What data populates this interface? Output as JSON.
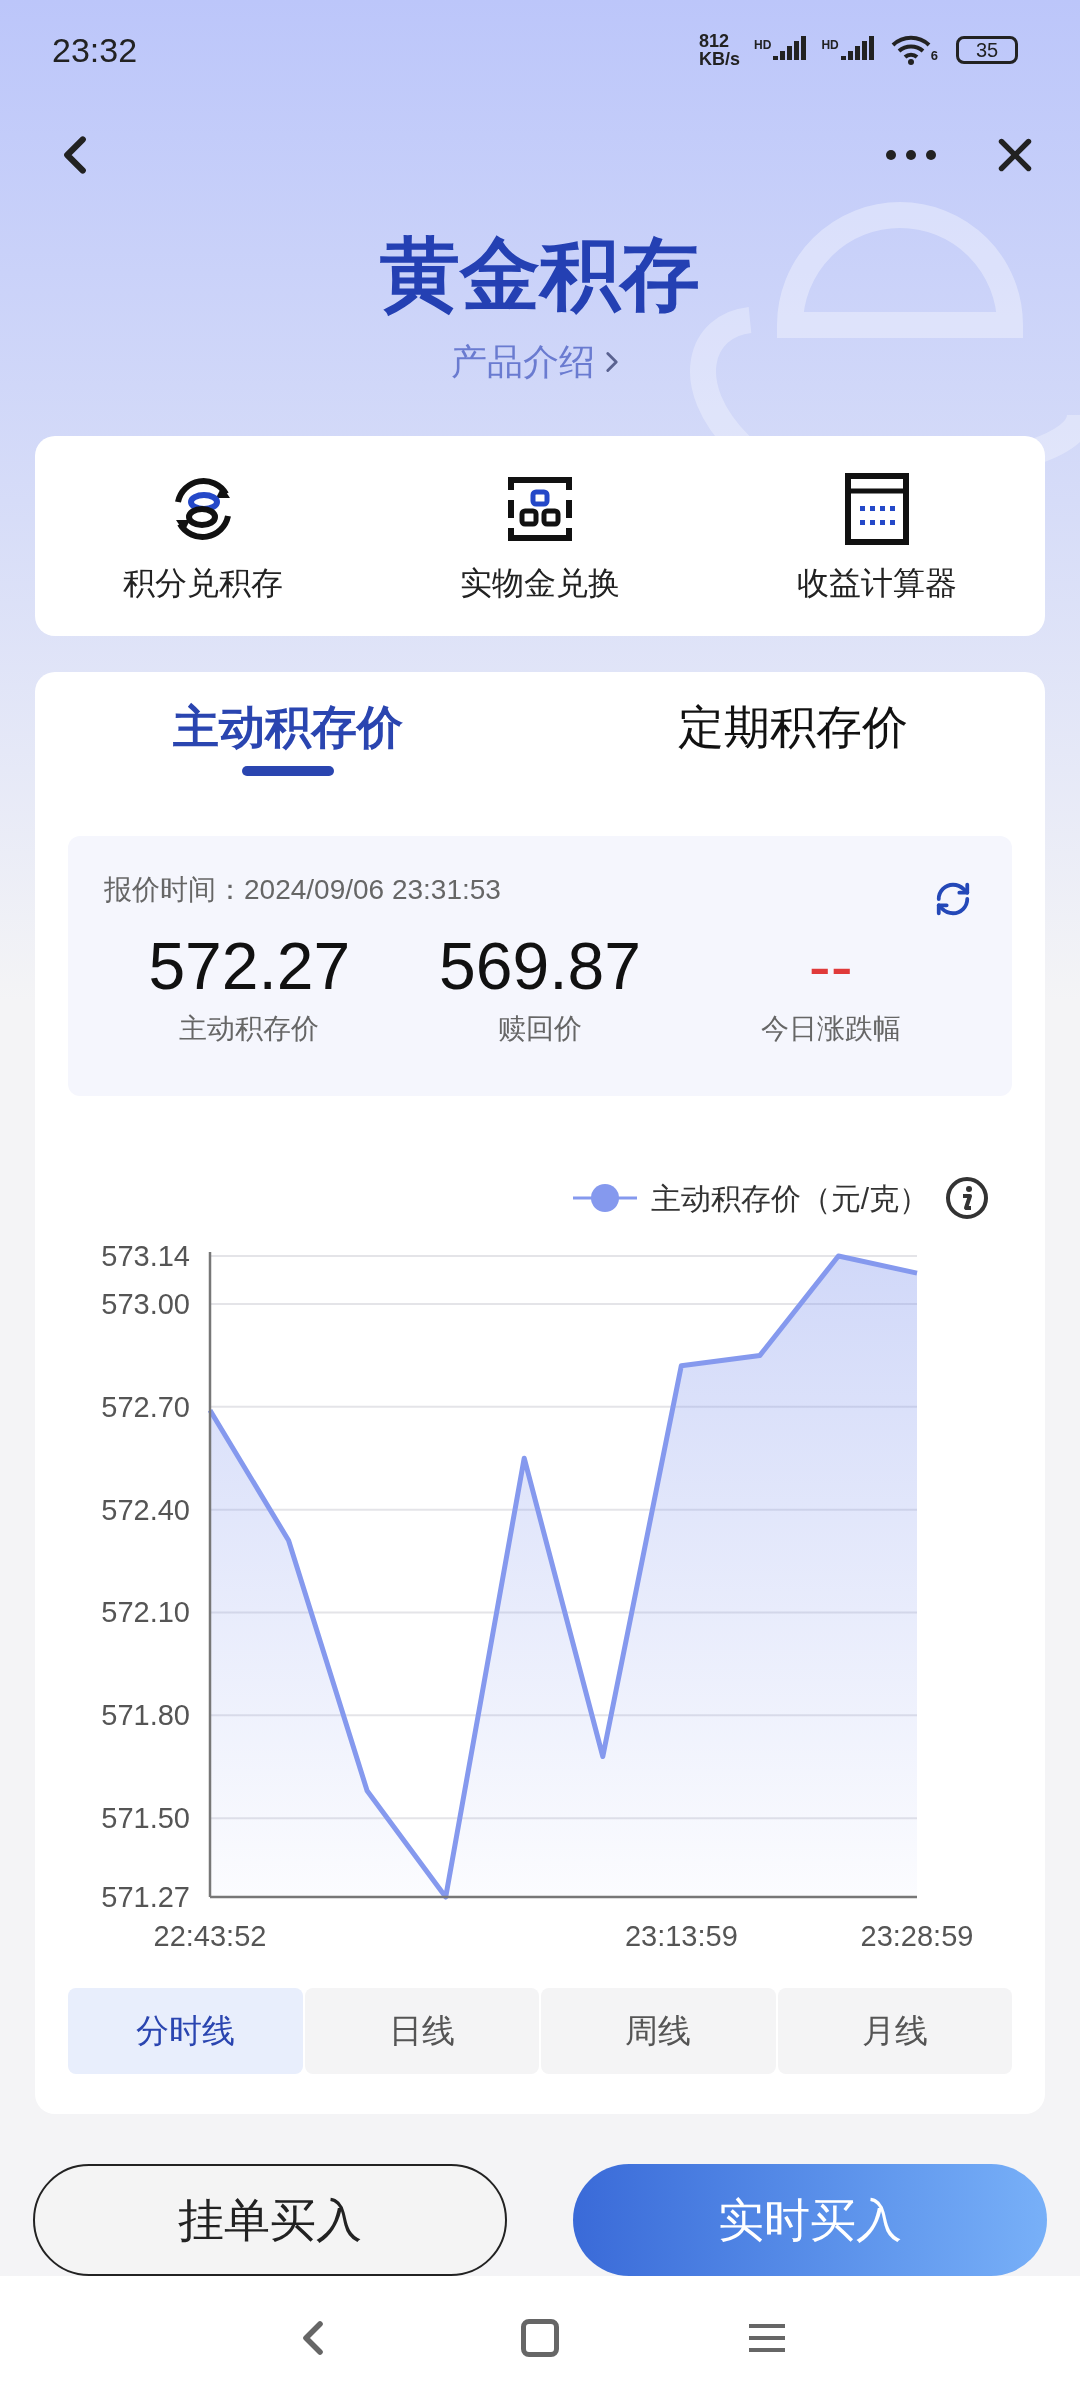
{
  "status_bar": {
    "time": "23:32",
    "speed_value": "812",
    "speed_unit": "KB/s",
    "signal_labels": [
      "HD",
      "HD"
    ],
    "wifi_label": "6",
    "battery": "35"
  },
  "header": {
    "title": "黄金积存",
    "subtitle": "产品介绍"
  },
  "shortcuts": [
    {
      "label": "积分兑积存",
      "kind": "exchange"
    },
    {
      "label": "实物金兑换",
      "kind": "bars"
    },
    {
      "label": "收益计算器",
      "kind": "calculator"
    }
  ],
  "tabs": [
    {
      "label": "主动积存价",
      "selected": true
    },
    {
      "label": "定期积存价",
      "selected": false
    }
  ],
  "quote": {
    "time": "报价时间：2024/09/06 23:31:53",
    "stats": [
      {
        "value": "572.27",
        "label": "主动积存价",
        "color": "#111111"
      },
      {
        "value": "569.87",
        "label": "赎回价",
        "color": "#111111"
      },
      {
        "value": "--",
        "label": "今日涨跌幅",
        "color": "#e03a3a"
      }
    ]
  },
  "chart": {
    "chart_data": {
      "type": "area",
      "grid": true,
      "categories": [
        "22:43:52",
        null,
        null,
        null,
        null,
        null,
        "23:13:59",
        null,
        null,
        "23:28:59"
      ],
      "series": [
        {
          "name": "主动积存价（元/克）",
          "color": "#8599ee",
          "values": [
            572.69,
            572.31,
            571.58,
            571.27,
            572.55,
            571.68,
            572.82,
            572.85,
            573.14,
            573.09
          ]
        }
      ],
      "ylim": [
        571.27,
        573.14
      ],
      "yticks": [
        {
          "value": 571.27,
          "label": "571.27"
        },
        {
          "value": 571.5,
          "label": "571.50"
        },
        {
          "value": 571.8,
          "label": "571.80"
        },
        {
          "value": 572.1,
          "label": "572.10"
        },
        {
          "value": 572.4,
          "label": "572.40"
        },
        {
          "value": 572.7,
          "label": "572.70"
        },
        {
          "value": 573.0,
          "label": "573.00"
        },
        {
          "value": 573.14,
          "label": "573.14"
        }
      ]
    }
  },
  "periods": [
    {
      "label": "分时线",
      "selected": true
    },
    {
      "label": "日线",
      "selected": false
    },
    {
      "label": "周线",
      "selected": false
    },
    {
      "label": "月线",
      "selected": false
    }
  ],
  "buttons": [
    {
      "label": "挂单买入",
      "kind": "outline"
    },
    {
      "label": "实时买入",
      "kind": "primary"
    }
  ]
}
